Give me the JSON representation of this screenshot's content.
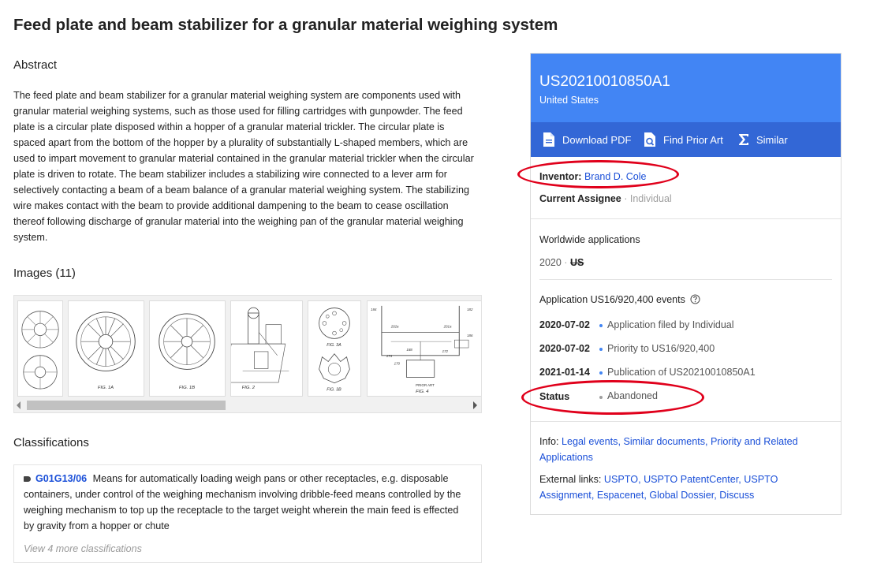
{
  "title": "Feed plate and beam stabilizer for a granular material weighing system",
  "abstract": {
    "heading": "Abstract",
    "text": "The feed plate and beam stabilizer for a granular material weighing system are components used with granular material weighing systems, such as those used for filling cartridges with gunpowder. The feed plate is a circular plate disposed within a hopper of a granular material trickler. The circular plate is spaced apart from the bottom of the hopper by a plurality of substantially L-shaped members, which are used to impart movement to granular material contained in the granular material trickler when the circular plate is driven to rotate. The beam stabilizer includes a stabilizing wire connected to a lever arm for selectively contacting a beam of a beam balance of a granular material weighing system. The stabilizing wire makes contact with the beam to provide additional dampening to the beam to cease oscillation thereof following discharge of granular material into the weighing pan of the granular material weighing system."
  },
  "images": {
    "heading": "Images (11)",
    "captions": [
      "FIG. 1A",
      "FIG. 1B",
      "FIG. 2",
      "FIG. 3A",
      "FIG. 3B",
      "FIG. 4"
    ],
    "prior_art_label": "PRIOR ART",
    "ref_numbers": [
      "184",
      "182",
      "202a",
      "201a",
      "188",
      "186",
      "174",
      "172",
      "170"
    ],
    "scroll_fraction": 0.45
  },
  "classifications": {
    "heading": "Classifications",
    "code": "G01G13/06",
    "description": "Means for automatically loading weigh pans or other receptacles, e.g. disposable containers, under control of the weighing mechanism involving dribble-feed means controlled by the weighing mechanism to top up the receptacle to the target weight wherein the main feed is effected by gravity from a hopper or chute",
    "more": "View 4 more classifications"
  },
  "panel": {
    "pub_number": "US20210010850A1",
    "country": "United States",
    "actions": {
      "download": "Download PDF",
      "prior_art": "Find Prior Art",
      "similar": "Similar"
    },
    "inventor_label": "Inventor:",
    "inventor_name": "Brand D. Cole",
    "assignee_label": "Current Assignee",
    "assignee_sep": "·",
    "assignee_value": "Individual",
    "worldwide_heading": "Worldwide applications",
    "worldwide_year": "2020",
    "worldwide_sep": "·",
    "worldwide_country": "US",
    "events_heading": "Application US16/920,400 events",
    "events": [
      {
        "date": "2020-07-02",
        "text": "Application filed by Individual"
      },
      {
        "date": "2020-07-02",
        "text": "Priority to US16/920,400"
      },
      {
        "date": "2021-01-14",
        "text": "Publication of US20210010850A1"
      }
    ],
    "status_label": "Status",
    "status_value": "Abandoned",
    "info_label": "Info:",
    "info_links": [
      "Legal events",
      "Similar documents",
      "Priority and Related Applications"
    ],
    "external_label": "External links:",
    "external_links": [
      "USPTO",
      "USPTO PatentCenter",
      "USPTO Assignment",
      "Espacenet",
      "Global Dossier",
      "Discuss"
    ]
  },
  "colors": {
    "panel_header": "#4285f4",
    "panel_actions": "#3367d6",
    "link": "#1a4fd8",
    "annotation": "#e0001b"
  }
}
